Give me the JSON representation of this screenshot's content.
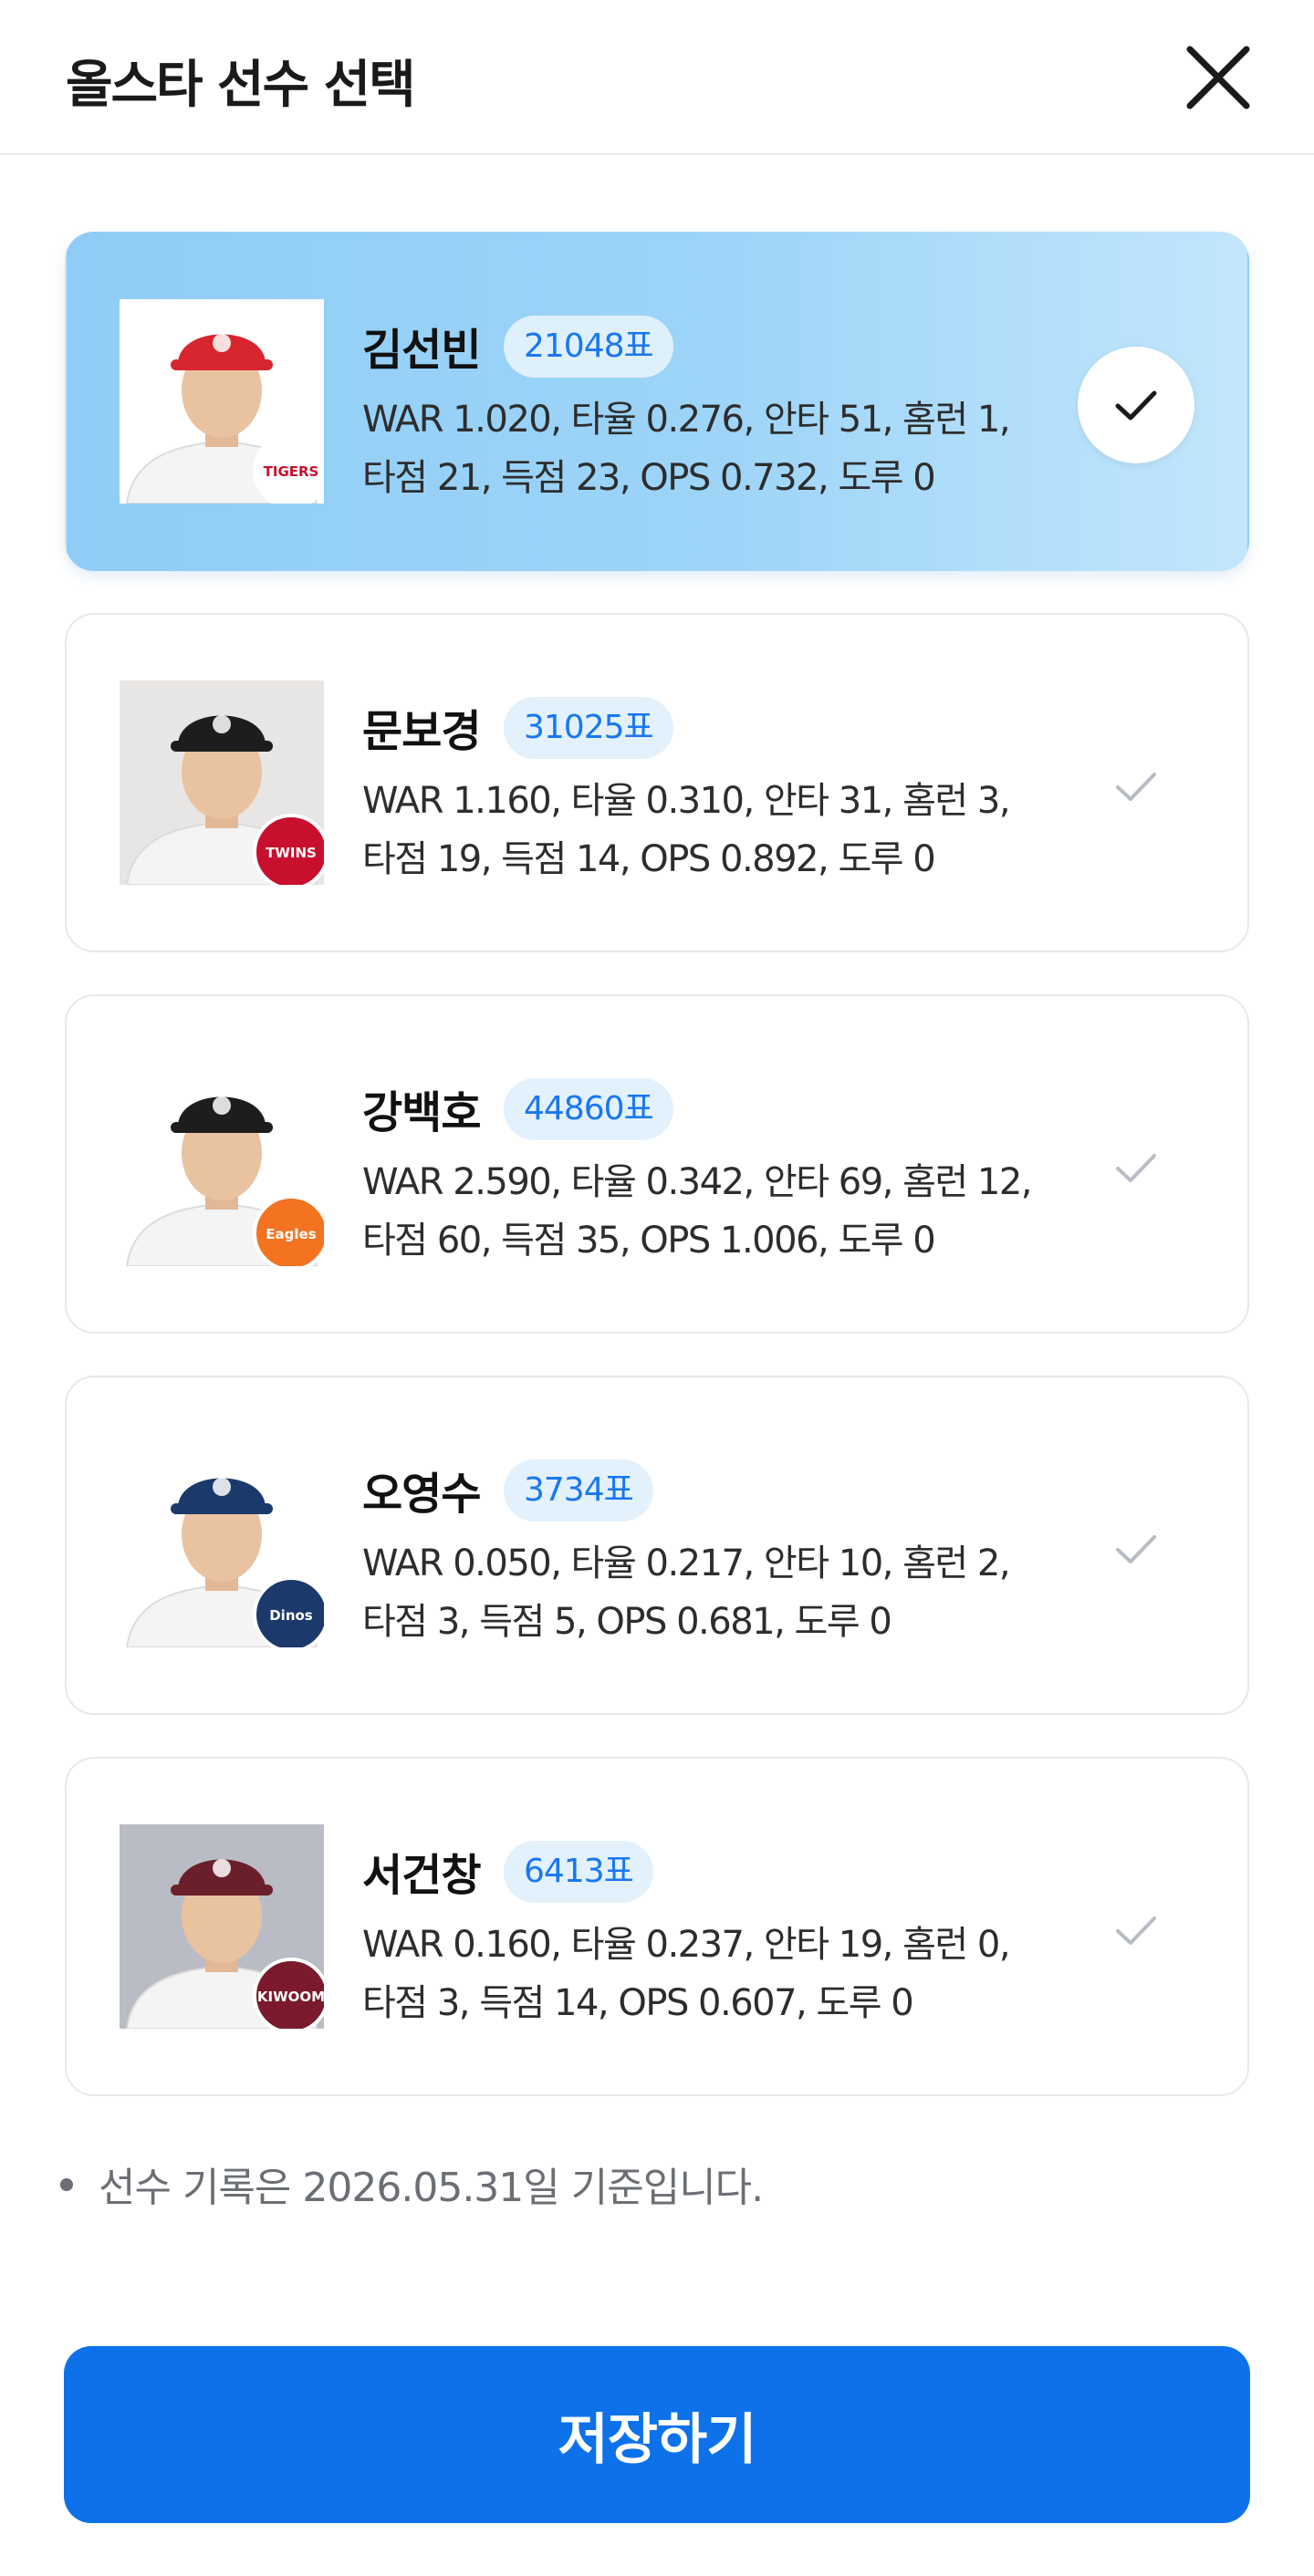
{
  "header": {
    "title": "올스타 선수 선택",
    "close_icon": "close-icon"
  },
  "players": [
    {
      "name": "김선빈",
      "votes": "21048표",
      "stats_line1": "WAR 1.020, 타율 0.276, 안타 51, 홈런 1,",
      "stats_line2": "타점 21, 득점 23, OPS 0.732, 도루 0",
      "selected": true,
      "team_badge": "TIGERS",
      "cap_color": "#d7262e",
      "badge_color": "#ffffff"
    },
    {
      "name": "문보경",
      "votes": "31025표",
      "stats_line1": "WAR 1.160, 타율 0.310, 안타 31, 홈런 3,",
      "stats_line2": "타점 19, 득점 14, OPS 0.892, 도루 0",
      "selected": false,
      "team_badge": "TWINS",
      "cap_color": "#1d1d1d",
      "badge_color": "#c8102e"
    },
    {
      "name": "강백호",
      "votes": "44860표",
      "stats_line1": "WAR 2.590, 타율 0.342, 안타 69, 홈런 12,",
      "stats_line2": "타점 60, 득점 35, OPS 1.006, 도루 0",
      "selected": false,
      "team_badge": "Eagles",
      "cap_color": "#1d1d1d",
      "badge_color": "#f37321"
    },
    {
      "name": "오영수",
      "votes": "3734표",
      "stats_line1": "WAR 0.050, 타율 0.217, 안타 10, 홈런 2,",
      "stats_line2": "타점 3, 득점 5, OPS 0.681, 도루 0",
      "selected": false,
      "team_badge": "Dinos",
      "cap_color": "#1b3a6b",
      "badge_color": "#1b3a6b"
    },
    {
      "name": "서건창",
      "votes": "6413표",
      "stats_line1": "WAR 0.160, 타율 0.237, 안타 19, 홈런 0,",
      "stats_line2": "타점 3, 득점 14, OPS 0.607, 도루 0",
      "selected": false,
      "team_badge": "KIWOOM",
      "cap_color": "#6b1f2b",
      "badge_color": "#7a1a2c"
    }
  ],
  "note": "선수 기록은 2026.05.31일 기준입니다.",
  "save_label": "저장하기",
  "colors": {
    "primary": "#0d72ea",
    "selected_card": "#9dd4f8",
    "vote_text": "#1877f2"
  }
}
